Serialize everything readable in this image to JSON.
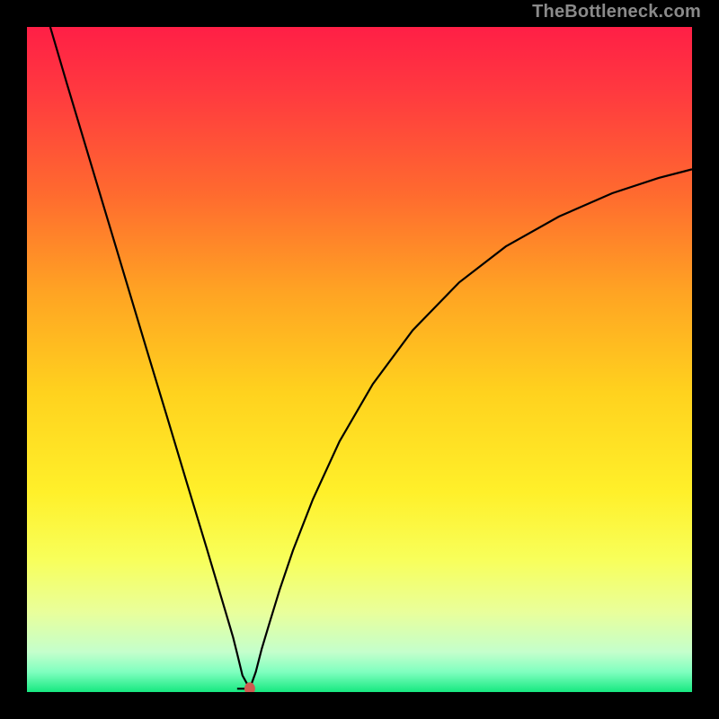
{
  "watermark": "TheBottleneck.com",
  "chart_data": {
    "type": "line",
    "title": "",
    "xlabel": "",
    "ylabel": "",
    "xlim": [
      0,
      100
    ],
    "ylim": [
      0,
      100
    ],
    "grid": false,
    "background_gradient": [
      {
        "stop": 0.0,
        "color": "#ff1f46"
      },
      {
        "stop": 0.1,
        "color": "#ff3a3f"
      },
      {
        "stop": 0.25,
        "color": "#ff6a2f"
      },
      {
        "stop": 0.4,
        "color": "#ffa423"
      },
      {
        "stop": 0.55,
        "color": "#ffd21e"
      },
      {
        "stop": 0.7,
        "color": "#fff02a"
      },
      {
        "stop": 0.8,
        "color": "#f8ff5a"
      },
      {
        "stop": 0.88,
        "color": "#e9ff9b"
      },
      {
        "stop": 0.94,
        "color": "#c4ffcc"
      },
      {
        "stop": 0.97,
        "color": "#7fffbf"
      },
      {
        "stop": 1.0,
        "color": "#17e880"
      }
    ],
    "minimum_marker": {
      "x": 33.5,
      "y": 0.5,
      "color": "#d05a50",
      "rx": 6,
      "ry": 7
    },
    "curve_color": "#000000",
    "curve_width": 2.2,
    "series": [
      {
        "name": "left-branch",
        "x": [
          3.5,
          6,
          9,
          12,
          15,
          18,
          21,
          24,
          27,
          30,
          31,
          31.6,
          32.4,
          33.5
        ],
        "y": [
          100,
          91.5,
          81.5,
          71.5,
          61.5,
          51.5,
          41.6,
          31.6,
          21.7,
          11.6,
          8.2,
          5.8,
          2.5,
          0.5
        ]
      },
      {
        "name": "flat-segment",
        "x": [
          31.6,
          33.5
        ],
        "y": [
          0.5,
          0.5
        ]
      },
      {
        "name": "right-branch",
        "x": [
          33.5,
          34.4,
          35.3,
          36.5,
          38,
          40,
          43,
          47,
          52,
          58,
          65,
          72,
          80,
          88,
          95,
          100
        ],
        "y": [
          0.5,
          3.0,
          6.5,
          10.5,
          15.4,
          21.3,
          29.0,
          37.7,
          46.3,
          54.4,
          61.6,
          67.0,
          71.5,
          75.0,
          77.3,
          78.6
        ]
      }
    ]
  }
}
